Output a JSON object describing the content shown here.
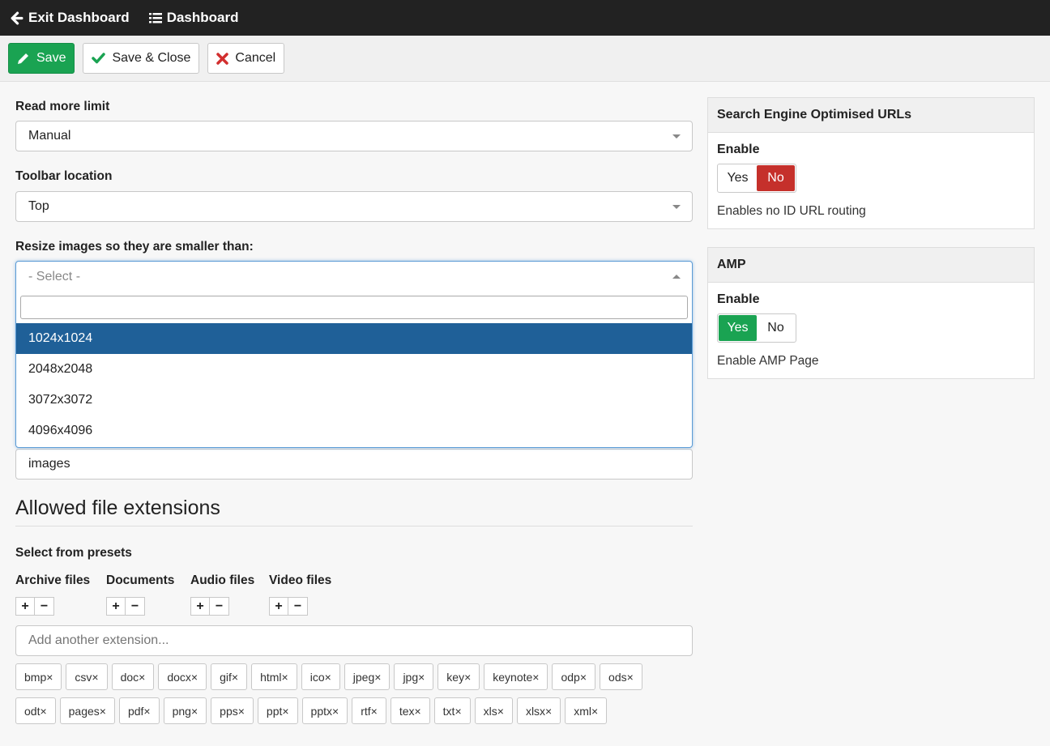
{
  "topbar": {
    "exit_label": "Exit Dashboard",
    "dashboard_label": "Dashboard"
  },
  "toolbar": {
    "save_label": "Save",
    "save_close_label": "Save & Close",
    "cancel_label": "Cancel"
  },
  "colors": {
    "save": "#1aa352",
    "cancel_icon": "#d22f2f",
    "toggle_no": "#c5302b",
    "toggle_yes": "#1aa352",
    "highlight": "#1f6098"
  },
  "form": {
    "read_more": {
      "label": "Read more limit",
      "value": "Manual"
    },
    "toolbar_location": {
      "label": "Toolbar location",
      "value": "Top"
    },
    "resize": {
      "label": "Resize images so they are smaller than:",
      "placeholder": "- Select -",
      "options": [
        "1024x1024",
        "2048x2048",
        "3072x3072",
        "4096x4096"
      ]
    },
    "images_value": "images",
    "extensions_heading": "Allowed file extensions",
    "presets_label": "Select from presets",
    "presets": [
      "Archive files",
      "Documents",
      "Audio files",
      "Video files"
    ],
    "add_extension_placeholder": "Add another extension...",
    "tags_row1": [
      "bmp×",
      "csv×",
      "doc×",
      "docx×",
      "gif×",
      "html×",
      "ico×",
      "jpeg×",
      "jpg×",
      "key×",
      "keynote×",
      "odp×",
      "ods×"
    ],
    "tags_row2": [
      "odt×",
      "pages×",
      "pdf×",
      "png×",
      "pps×",
      "ppt×",
      "pptx×",
      "rtf×",
      "tex×",
      "txt×",
      "xls×",
      "xlsx×",
      "xml×"
    ]
  },
  "seo_panel": {
    "title": "Search Engine Optimised URLs",
    "enable_label": "Enable",
    "yes": "Yes",
    "no": "No",
    "description": "Enables no ID URL routing"
  },
  "amp_panel": {
    "title": "AMP",
    "enable_label": "Enable",
    "yes": "Yes",
    "no": "No",
    "description": "Enable AMP Page"
  }
}
